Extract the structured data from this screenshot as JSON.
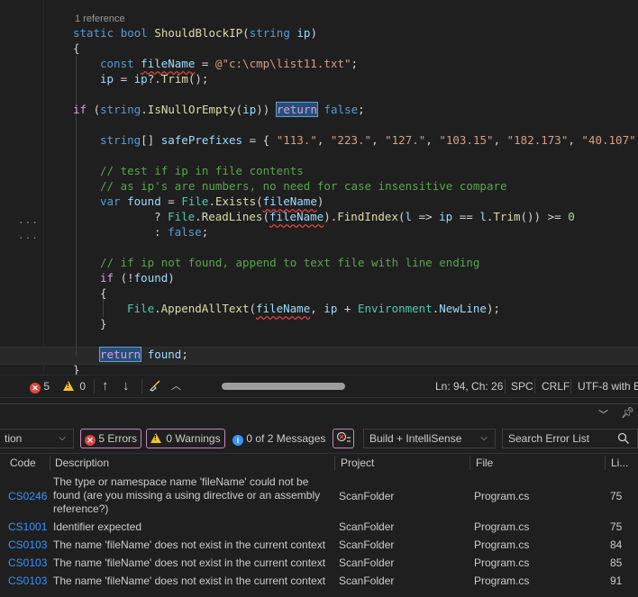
{
  "editor": {
    "codelens": "1 reference",
    "lines": [
      [
        [
          "static ",
          "k"
        ],
        [
          "bool ",
          "k"
        ],
        [
          "ShouldBlockIP",
          "m"
        ],
        [
          "(",
          "p"
        ],
        [
          "string ",
          "k"
        ],
        [
          "ip",
          "v"
        ],
        [
          ")",
          "p"
        ]
      ],
      [
        [
          "{",
          "p"
        ]
      ],
      [
        [
          "const ",
          "k"
        ],
        [
          "fileName",
          "v squig"
        ],
        [
          " = ",
          "p"
        ],
        [
          "@\"c:\\cmp\\list11.txt\"",
          "str"
        ],
        [
          ";",
          "p"
        ]
      ],
      [
        [
          "ip",
          "v"
        ],
        [
          " = ",
          "p"
        ],
        [
          "ip",
          "v"
        ],
        [
          "?.",
          "p"
        ],
        [
          "Trim",
          "m"
        ],
        [
          "();",
          "p"
        ]
      ],
      [],
      [
        [
          "if ",
          "kc"
        ],
        [
          "(",
          "p"
        ],
        [
          "string",
          "k"
        ],
        [
          ".",
          "p"
        ],
        [
          "IsNullOrEmpty",
          "m"
        ],
        [
          "(",
          "p"
        ],
        [
          "ip",
          "v"
        ],
        [
          ")) ",
          "p"
        ],
        [
          "return",
          "kc hl-box"
        ],
        [
          " ",
          "p"
        ],
        [
          "false",
          "k"
        ],
        [
          ";",
          "p"
        ]
      ],
      [],
      [
        [
          "string",
          "k"
        ],
        [
          "[] ",
          "p"
        ],
        [
          "safePrefixes",
          "v"
        ],
        [
          " = { ",
          "p"
        ],
        [
          "\"113.\"",
          "str"
        ],
        [
          ", ",
          "p"
        ],
        [
          "\"223.\"",
          "str"
        ],
        [
          ", ",
          "p"
        ],
        [
          "\"127.\"",
          "str"
        ],
        [
          ", ",
          "p"
        ],
        [
          "\"103.15\"",
          "str"
        ],
        [
          ", ",
          "p"
        ],
        [
          "\"182.173\"",
          "str"
        ],
        [
          ", ",
          "p"
        ],
        [
          "\"40.107\"",
          "str"
        ]
      ],
      [],
      [
        [
          "// test if ip in file contents",
          "c"
        ]
      ],
      [
        [
          "// as ip's are numbers, no need for case insensitive compare",
          "c"
        ]
      ],
      [
        [
          "var ",
          "k"
        ],
        [
          "found",
          "v"
        ],
        [
          " = ",
          "p"
        ],
        [
          "File",
          "t"
        ],
        [
          ".",
          "p"
        ],
        [
          "Exists",
          "m"
        ],
        [
          "(",
          "p"
        ],
        [
          "fileName",
          "v squig"
        ],
        [
          ")",
          "p"
        ]
      ],
      [
        [
          "? ",
          "p"
        ],
        [
          "File",
          "t"
        ],
        [
          ".",
          "p"
        ],
        [
          "ReadLines",
          "m"
        ],
        [
          "(",
          "p"
        ],
        [
          "fileName",
          "v squig"
        ],
        [
          ").",
          "p"
        ],
        [
          "FindIndex",
          "m"
        ],
        [
          "(",
          "p"
        ],
        [
          "l",
          "v"
        ],
        [
          " => ",
          "p"
        ],
        [
          "ip",
          "v"
        ],
        [
          " == ",
          "p"
        ],
        [
          "l",
          "v"
        ],
        [
          ".",
          "p"
        ],
        [
          "Trim",
          "m"
        ],
        [
          "()) >= ",
          "p"
        ],
        [
          "0",
          "n"
        ]
      ],
      [
        [
          ": ",
          "p"
        ],
        [
          "false",
          "k"
        ],
        [
          ";",
          "p"
        ]
      ],
      [],
      [
        [
          "// if ip not found, append to text file with line ending",
          "c"
        ]
      ],
      [
        [
          "if ",
          "kc"
        ],
        [
          "(!",
          "p"
        ],
        [
          "found",
          "v"
        ],
        [
          ")",
          "p"
        ]
      ],
      [
        [
          "{",
          "p"
        ]
      ],
      [
        [
          "File",
          "t"
        ],
        [
          ".",
          "p"
        ],
        [
          "AppendAllText",
          "m"
        ],
        [
          "(",
          "p"
        ],
        [
          "fileName",
          "v squig"
        ],
        [
          ", ",
          "p"
        ],
        [
          "ip",
          "v"
        ],
        [
          " + ",
          "p"
        ],
        [
          "Environment",
          "t"
        ],
        [
          ".",
          "p"
        ],
        [
          "NewLine",
          "v"
        ],
        [
          ");",
          "p"
        ]
      ],
      [
        [
          "}",
          "p"
        ]
      ],
      [],
      [
        [
          "return",
          "kc hl-box"
        ],
        [
          " ",
          "p"
        ],
        [
          "found",
          "v"
        ],
        [
          ";",
          "p"
        ]
      ],
      [
        [
          "}",
          "p"
        ]
      ]
    ]
  },
  "statusbar": {
    "errors": "5",
    "warnings": "0",
    "position": "Ln: 94, Ch: 26",
    "indent": "SPC",
    "line_ending": "CRLF",
    "encoding": "UTF-8 with B"
  },
  "toolbar": {
    "scope": "tion",
    "errors_btn": "5 Errors",
    "warnings_btn": "0 Warnings",
    "messages_btn": "0 of 2 Messages",
    "build_filter": "Build + IntelliSense",
    "search_placeholder": "Search Error List"
  },
  "errorlist": {
    "headers": {
      "code": "Code",
      "description": "Description",
      "project": "Project",
      "file": "File",
      "line": "Li..."
    },
    "rows": [
      {
        "code": "CS0246",
        "description": "The type or namespace name 'fileName' could not be found (are you missing a using directive or an assembly reference?)",
        "project": "ScanFolder",
        "file": "Program.cs",
        "line": "75"
      },
      {
        "code": "CS1001",
        "description": "Identifier expected",
        "project": "ScanFolder",
        "file": "Program.cs",
        "line": "75"
      },
      {
        "code": "CS0103",
        "description": "The name 'fileName' does not exist in the current context",
        "project": "ScanFolder",
        "file": "Program.cs",
        "line": "84"
      },
      {
        "code": "CS0103",
        "description": "The name 'fileName' does not exist in the current context",
        "project": "ScanFolder",
        "file": "Program.cs",
        "line": "85"
      },
      {
        "code": "CS0103",
        "description": "The name 'fileName' does not exist in the current context",
        "project": "ScanFolder",
        "file": "Program.cs",
        "line": "91"
      }
    ]
  },
  "colors": {
    "error": "#e0443e",
    "warning": "#f2c12e",
    "info": "#3794ff",
    "filter_border": "#c586c0"
  }
}
